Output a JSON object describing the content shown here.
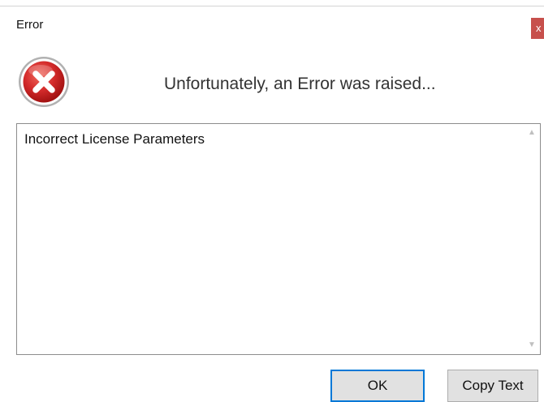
{
  "window": {
    "title": "Error",
    "close_label": "x"
  },
  "dialog": {
    "icon": "error-icon",
    "headline": "Unfortunately, an Error was raised...",
    "message": "Incorrect License Parameters"
  },
  "buttons": {
    "ok_label": "OK",
    "copy_label": "Copy Text"
  },
  "colors": {
    "close_button": "#c7504c",
    "error_icon": "#d42b2b",
    "focus_border": "#0078d7"
  },
  "scrollbar": {
    "up_icon": "scroll-up-arrow-icon",
    "down_icon": "scroll-down-arrow-icon"
  }
}
